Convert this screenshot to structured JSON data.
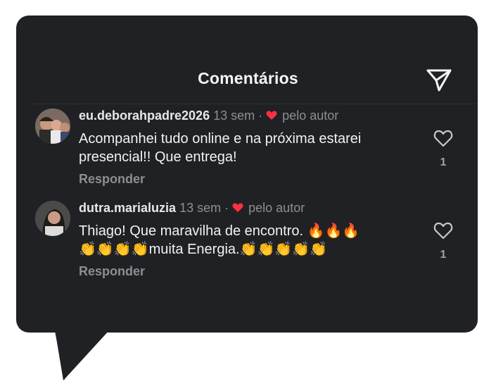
{
  "header": {
    "title": "Comentários",
    "send_icon": "send-icon"
  },
  "comments": [
    {
      "username": "eu.deborahpadre2026",
      "time": "13 sem",
      "separator": "·",
      "liked_by_author": "pelo autor",
      "text": "Acompanhei tudo online e na próxima estarei presencial!! Que entrega!",
      "reply_label": "Responder",
      "like_count": "1"
    },
    {
      "username": "dutra.marialuzia",
      "time": "13 sem",
      "separator": "·",
      "liked_by_author": "pelo autor",
      "text_line1": "Thiago! Que maravilha de encontro. 🔥🔥🔥",
      "text_line2": "👏👏👏👏muita Energia.👏👏👏👏👏",
      "reply_label": "Responder",
      "like_count": "1"
    }
  ],
  "colors": {
    "background": "#202124",
    "author_heart": "#ff3040",
    "text": "#f2f2f2",
    "muted": "#8e8e93"
  }
}
